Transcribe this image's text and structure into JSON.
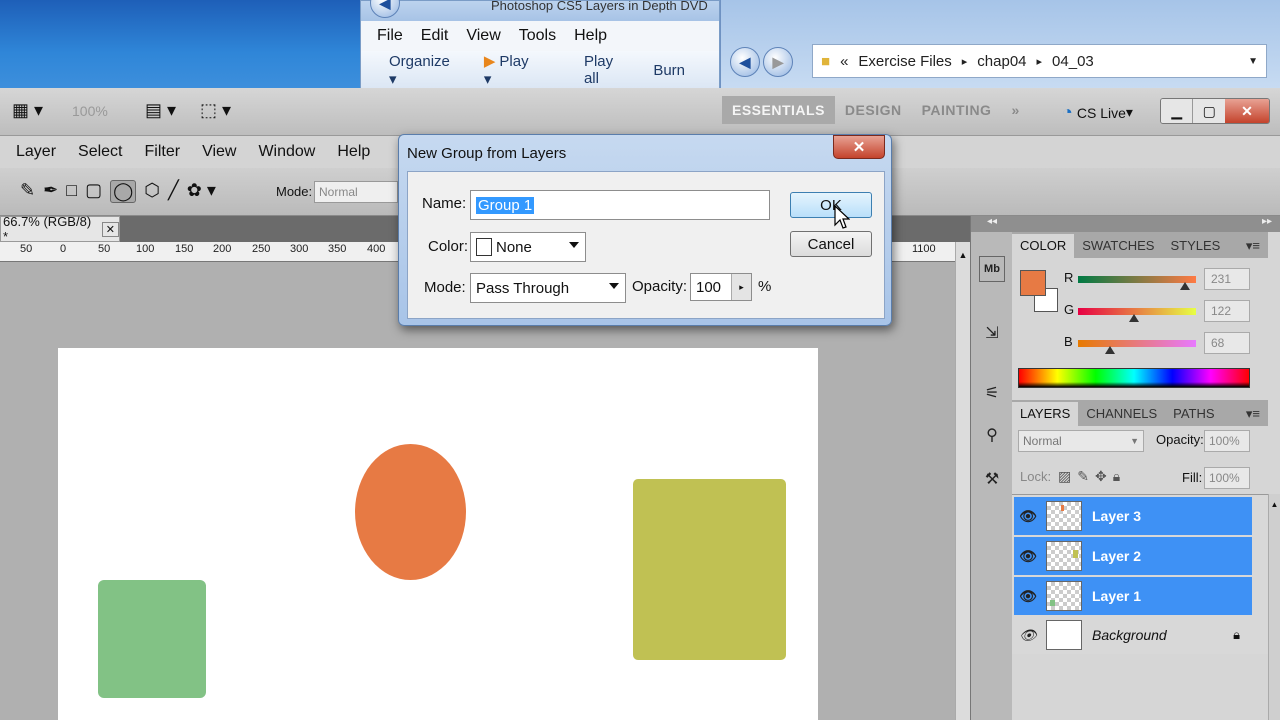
{
  "explorer": {
    "title": "Photoshop CS5 Layers in Depth DVD",
    "menu": [
      "File",
      "Edit",
      "View",
      "Tools",
      "Help"
    ],
    "commands": [
      "Organize ▾",
      "Play ▾",
      "Play all",
      "Burn"
    ],
    "breadcrumb": [
      "«",
      "Exercise Files",
      "chap04",
      "04_03"
    ]
  },
  "photoshop": {
    "zoom": "100%",
    "workspaces": [
      "ESSENTIALS",
      "DESIGN",
      "PAINTING"
    ],
    "cs_live": "CS Live",
    "menu": [
      "Layer",
      "Select",
      "Filter",
      "View",
      "Window",
      "Help"
    ],
    "options": {
      "mode_label": "Mode:",
      "mode_value": "Normal"
    },
    "doc_tab": "66.7% (RGB/8) *",
    "ruler_ticks": [
      "50",
      "0",
      "50",
      "100",
      "150",
      "200",
      "250",
      "300",
      "350",
      "400",
      "1100"
    ]
  },
  "color_panel": {
    "tabs": [
      "COLOR",
      "SWATCHES",
      "STYLES"
    ],
    "foreground": "#e77a44",
    "channels": [
      {
        "label": "R",
        "value": "231",
        "fraction": 0.906
      },
      {
        "label": "G",
        "value": "122",
        "fraction": 0.478
      },
      {
        "label": "B",
        "value": "68",
        "fraction": 0.267
      }
    ]
  },
  "layers_panel": {
    "tabs": [
      "LAYERS",
      "CHANNELS",
      "PATHS"
    ],
    "blend_mode": "Normal",
    "opacity_label": "Opacity:",
    "opacity_value": "100%",
    "lock_label": "Lock:",
    "fill_label": "Fill:",
    "fill_value": "100%",
    "layers": [
      {
        "name": "Layer 3",
        "selected": true
      },
      {
        "name": "Layer 2",
        "selected": true
      },
      {
        "name": "Layer 1",
        "selected": true
      },
      {
        "name": "Background",
        "selected": false
      }
    ]
  },
  "dialog": {
    "title": "New Group from Layers",
    "name_label": "Name:",
    "name_value": "Group 1",
    "color_label": "Color:",
    "color_value": "None",
    "mode_label": "Mode:",
    "mode_value": "Pass Through",
    "opacity_label": "Opacity:",
    "opacity_value": "100",
    "opacity_unit": "%",
    "ok_label": "OK",
    "cancel_label": "Cancel"
  },
  "colors": {
    "orange": "#e77a44",
    "green": "#82c285",
    "olive": "#c0c153",
    "selection": "#3e91f5"
  }
}
